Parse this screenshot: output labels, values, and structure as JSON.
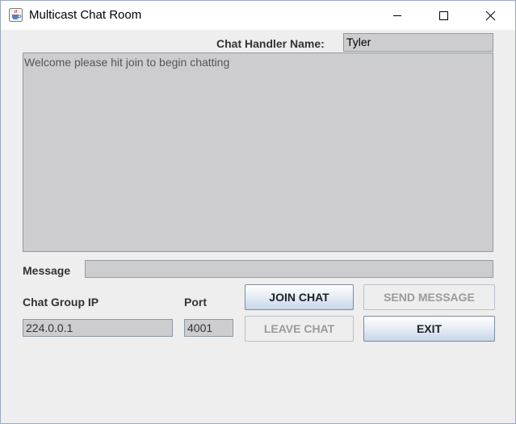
{
  "window": {
    "title": "Multicast Chat Room",
    "icon": "java-cup-icon",
    "controls": [
      "minimize-icon",
      "maximize-icon",
      "close-icon"
    ]
  },
  "handler": {
    "label": "Chat Handler Name:",
    "value": "Tyler"
  },
  "chat": {
    "text": "Welcome please hit join to begin chatting"
  },
  "message": {
    "label": "Message",
    "value": ""
  },
  "group": {
    "ip_label": "Chat Group IP",
    "ip_value": "224.0.0.1",
    "port_label": "Port",
    "port_value": "4001"
  },
  "buttons": {
    "join": "JOIN CHAT",
    "send": "SEND MESSAGE",
    "leave": "LEAVE CHAT",
    "exit": "EXIT"
  },
  "colors": {
    "window_bg": "#eeeeee",
    "field_bg": "#cdcdcf",
    "text_dark": "#333333",
    "disabled_text": "#9a9a9a"
  }
}
